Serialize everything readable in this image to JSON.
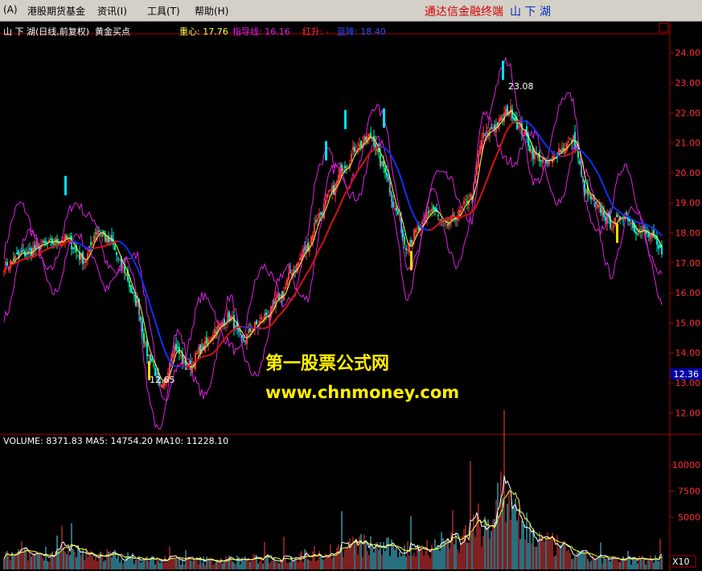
{
  "menubar": {
    "items": [
      "(A)",
      "港股期货基金",
      "资讯(I)",
      "工具(T)",
      "帮助(H)"
    ],
    "brand": "通达信金融终端",
    "stock": "山 下 湖"
  },
  "chart_header": {
    "stock_info": "山 下 湖(日线,前复权)",
    "indicator_name": "黄金买点",
    "center_label": "重心: 17.76",
    "guide_label": "指导线: 16.16",
    "rise_label": "红升: -",
    "fall_label": "蓝降: 18.40"
  },
  "price_axis": {
    "ticks": [
      "24.00",
      "23.00",
      "22.00",
      "21.00",
      "20.00",
      "19.00",
      "18.00",
      "17.00",
      "16.00",
      "15.00",
      "14.00",
      "13.00",
      "12.00"
    ],
    "current_price": "12.36"
  },
  "annotations": {
    "low": "12.65",
    "high": "23.08"
  },
  "volume_panel": {
    "header": "VOLUME: 8371.83  MA5: 14754.20  MA10: 11228.10",
    "ticks": [
      "10000",
      "7500",
      "5000"
    ],
    "unit": "X10"
  },
  "watermark": {
    "line1": "第一股票公式网",
    "line2": "www.chnmoney.com"
  },
  "colors": {
    "up": "#ff3c3c",
    "down": "#00e0e0",
    "ma": "#ffff40",
    "guide": "#e020e0",
    "upcolor_red": "#dd1010",
    "blue": "#1030ff"
  },
  "chart_data": {
    "type": "candlestick",
    "price_range": [
      11.5,
      24.5
    ],
    "volume_range": [
      0,
      12000
    ],
    "anchors_close": [
      [
        0,
        16.9
      ],
      [
        12,
        17.3
      ],
      [
        25,
        17.6
      ],
      [
        38,
        17.8
      ],
      [
        50,
        17.1
      ],
      [
        58,
        18.1
      ],
      [
        66,
        17.7
      ],
      [
        74,
        16.8
      ],
      [
        82,
        15.7
      ],
      [
        90,
        13.9
      ],
      [
        98,
        12.8
      ],
      [
        106,
        14.2
      ],
      [
        114,
        13.5
      ],
      [
        124,
        14.2
      ],
      [
        132,
        14.8
      ],
      [
        140,
        15.2
      ],
      [
        148,
        14.4
      ],
      [
        156,
        14.9
      ],
      [
        164,
        15.3
      ],
      [
        172,
        15.9
      ],
      [
        180,
        16.8
      ],
      [
        188,
        17.5
      ],
      [
        196,
        18.6
      ],
      [
        204,
        19.4
      ],
      [
        212,
        20.3
      ],
      [
        220,
        20.9
      ],
      [
        228,
        21.2
      ],
      [
        236,
        20.2
      ],
      [
        244,
        18.7
      ],
      [
        250,
        17.6
      ],
      [
        258,
        18.1
      ],
      [
        266,
        18.8
      ],
      [
        274,
        18.2
      ],
      [
        282,
        18.6
      ],
      [
        290,
        19.2
      ],
      [
        298,
        21.2
      ],
      [
        306,
        21.6
      ],
      [
        314,
        22.1
      ],
      [
        322,
        21.4
      ],
      [
        330,
        20.6
      ],
      [
        338,
        20.3
      ],
      [
        346,
        20.8
      ],
      [
        354,
        21.1
      ],
      [
        362,
        19.3
      ],
      [
        370,
        18.8
      ],
      [
        378,
        18.3
      ],
      [
        386,
        18.6
      ],
      [
        394,
        18.1
      ],
      [
        402,
        17.9
      ],
      [
        408,
        17.4
      ]
    ],
    "volume_anchors": [
      [
        0,
        1200
      ],
      [
        30,
        1500
      ],
      [
        60,
        1300
      ],
      [
        90,
        900
      ],
      [
        120,
        800
      ],
      [
        150,
        900
      ],
      [
        180,
        1100
      ],
      [
        200,
        1600
      ],
      [
        220,
        2200
      ],
      [
        250,
        1800
      ],
      [
        280,
        2600
      ],
      [
        300,
        4200
      ],
      [
        310,
        6500
      ],
      [
        320,
        4000
      ],
      [
        340,
        2200
      ],
      [
        360,
        1200
      ],
      [
        380,
        800
      ],
      [
        400,
        900
      ],
      [
        408,
        1200
      ]
    ]
  }
}
